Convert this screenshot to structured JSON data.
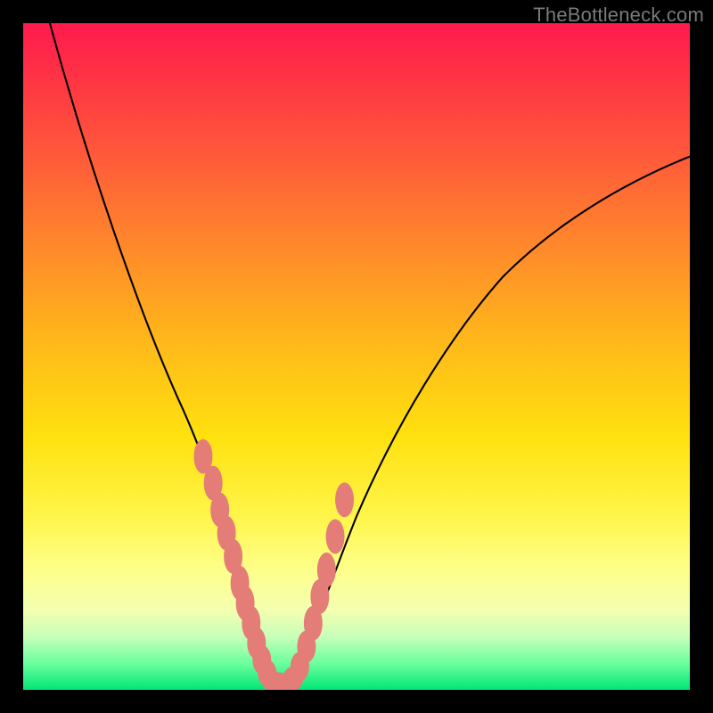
{
  "watermark": "TheBottleneck.com",
  "chart_data": {
    "type": "line",
    "title": "",
    "xlabel": "",
    "ylabel": "",
    "xlim": [
      0,
      100
    ],
    "ylim": [
      0,
      100
    ],
    "legend": false,
    "grid": false,
    "series": [
      {
        "name": "bottleneck-curve",
        "x": [
          4,
          8,
          12,
          16,
          20,
          24,
          28,
          30,
          32,
          34,
          36,
          38,
          40,
          44,
          48,
          52,
          56,
          60,
          64,
          70,
          76,
          82,
          88,
          94,
          100
        ],
        "y": [
          100,
          89,
          78,
          67,
          56,
          45,
          33,
          27,
          20,
          13,
          6,
          1,
          1,
          8,
          17,
          27,
          36,
          44,
          51,
          59,
          65,
          70,
          74,
          77,
          80
        ],
        "color": "#000000"
      }
    ],
    "markers": {
      "name": "highlighted-segment",
      "color": "#e47c77",
      "x": [
        27,
        28.5,
        29.5,
        30.5,
        31.5,
        32.5,
        33,
        34,
        35,
        36,
        37,
        37.5,
        38,
        39,
        40,
        41,
        42,
        43,
        44,
        45,
        46.5,
        48
      ],
      "y": [
        35,
        31,
        27,
        24,
        20,
        16,
        13,
        10,
        7,
        4,
        2,
        1,
        1,
        1,
        1,
        4,
        7,
        11,
        15,
        19,
        24,
        30
      ]
    }
  }
}
